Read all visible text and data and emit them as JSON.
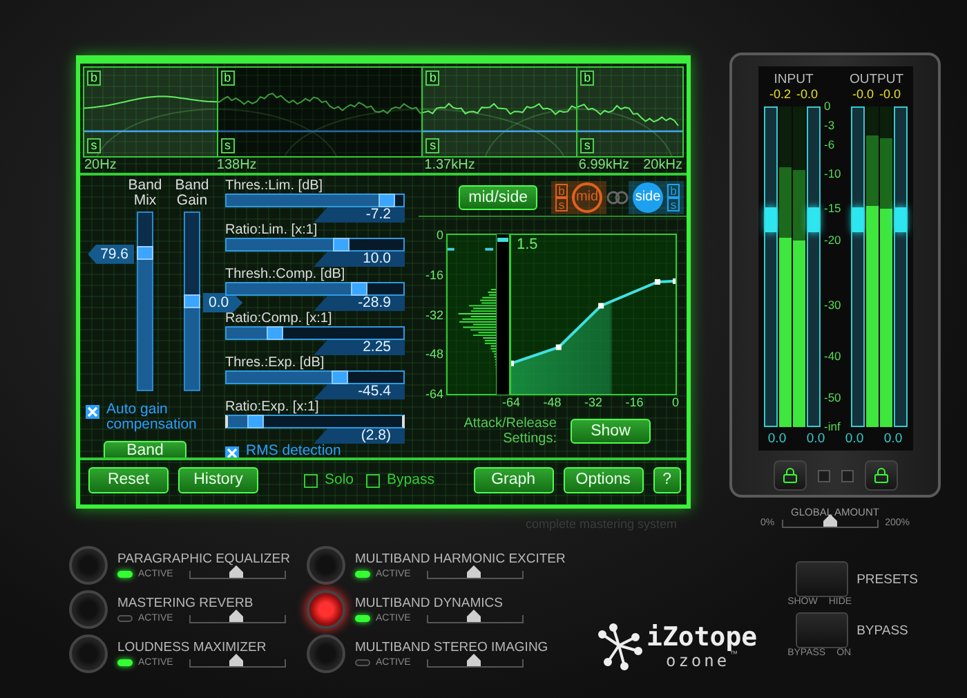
{
  "screen": {
    "spectrum": {
      "bands": [
        {
          "b": "b",
          "s": "s",
          "selected": false
        },
        {
          "b": "b",
          "s": "s",
          "selected": true
        },
        {
          "b": "b",
          "s": "s",
          "selected": false
        },
        {
          "b": "b",
          "s": "s",
          "selected": false
        }
      ],
      "freq_labels": [
        "20Hz",
        "138Hz",
        "1.37kHz",
        "6.99kHz",
        "20kHz"
      ]
    },
    "band_faders": [
      {
        "label": "Band Mix",
        "value": "79.6",
        "level": 0.77
      },
      {
        "label": "Band Gain",
        "value": "0.0",
        "level": 0.5
      }
    ],
    "auto_gain": {
      "label": "Auto gain compensation",
      "checked": true
    },
    "band_button": "Band",
    "sliders": [
      {
        "label": "Thres.:Lim. [dB]",
        "value": "-7.2",
        "level": 0.91,
        "selected": false
      },
      {
        "label": "Ratio:Lim. [x:1]",
        "value": "10.0",
        "level": 0.65,
        "selected": false
      },
      {
        "label": "Thresh.:Comp. [dB]",
        "value": "-28.9",
        "level": 0.75,
        "selected": false
      },
      {
        "label": "Ratio:Comp. [x:1]",
        "value": "2.25",
        "level": 0.27,
        "selected": false
      },
      {
        "label": "Thres.:Exp. [dB]",
        "value": "-45.4",
        "level": 0.64,
        "selected": false
      },
      {
        "label": "Ratio:Exp. [x:1]",
        "value": "(2.8)",
        "level": 0.16,
        "selected": true
      }
    ],
    "rms_detection": {
      "label": "RMS detection",
      "checked": true
    },
    "mid_side_button": "mid/side",
    "channels": [
      {
        "label": "mid",
        "b": "b",
        "s": "s",
        "selected": false,
        "color": "#e0601e"
      },
      {
        "label": "side",
        "b": "b",
        "s": "s",
        "selected": true,
        "color": "#1ea0f0"
      }
    ],
    "graph": {
      "ratio_reading": "1.5",
      "chart_data": {
        "type": "line",
        "x": [
          -64,
          -45.5,
          -29,
          -7,
          0
        ],
        "series": [
          {
            "color": "#40e0e0",
            "marker": "square",
            "values": [
              -51.7,
              -45.2,
              -28.5,
              -18.9,
              -18.6
            ]
          }
        ],
        "xlim": [
          -64,
          0
        ],
        "ylim": [
          -64,
          0
        ],
        "xticks": [
          {
            "value": -64,
            "label": "-64"
          },
          {
            "value": -48,
            "label": "-48"
          },
          {
            "value": -32,
            "label": "-32"
          },
          {
            "value": -16,
            "label": "-16"
          },
          {
            "value": 0,
            "label": "0"
          }
        ],
        "yticks": [
          {
            "value": 0,
            "label": "0"
          },
          {
            "value": -16,
            "label": "-16"
          },
          {
            "value": -32,
            "label": "-32"
          },
          {
            "value": -48,
            "label": "-48"
          },
          {
            "value": -64,
            "label": "-64"
          }
        ]
      }
    },
    "attack_release": {
      "label": "Attack/Release Settings:",
      "button": "Show"
    },
    "toolbar": [
      {
        "kind": "button",
        "label": "Reset"
      },
      {
        "kind": "button",
        "label": "History"
      },
      {
        "kind": "checkbox",
        "label": "Solo",
        "checked": false
      },
      {
        "kind": "checkbox",
        "label": "Bypass",
        "checked": false
      },
      {
        "kind": "button",
        "label": "Graph"
      },
      {
        "kind": "button",
        "label": "Options"
      },
      {
        "kind": "button",
        "label": "?"
      }
    ]
  },
  "tagline": "complete mastering system",
  "meters": {
    "groups": [
      {
        "title": "INPUT",
        "peaks": [
          "-0.2",
          "-0.0"
        ],
        "channel_levels": [
          {
            "level": 0.59
          },
          {
            "level": 0.58
          }
        ],
        "faders": [
          {
            "value": "0.0",
            "level": 0.65
          },
          {
            "value": "0.0",
            "level": 0.65
          }
        ]
      },
      {
        "title": "OUTPUT",
        "peaks": [
          "-0.0",
          "-0.0"
        ],
        "channel_levels": [
          {
            "level": 0.69
          },
          {
            "level": 0.68
          }
        ],
        "faders": [
          {
            "value": "0.0",
            "level": 0.65
          },
          {
            "value": "0.0",
            "level": 0.65
          }
        ]
      }
    ],
    "scale": [
      "0",
      "-3",
      "-6",
      "-10",
      "-15",
      "-20",
      "-30",
      "-40",
      "-50",
      "-inf"
    ]
  },
  "global_amount": {
    "label": "GLOBAL AMOUNT",
    "min": "0%",
    "max": "200%",
    "level": 0.5
  },
  "modules": [
    {
      "name": "PARAGRAPHIC EQUALIZER",
      "status": "ACTIVE",
      "active": true,
      "selected": false,
      "level": 0.48
    },
    {
      "name": "MULTIBAND HARMONIC EXCITER",
      "status": "ACTIVE",
      "active": true,
      "selected": false,
      "level": 0.48
    },
    {
      "name": "MASTERING REVERB",
      "status": "ACTIVE",
      "active": false,
      "selected": false,
      "level": 0.48
    },
    {
      "name": "MULTIBAND DYNAMICS",
      "status": "ACTIVE",
      "active": true,
      "selected": true,
      "level": 0.48
    },
    {
      "name": "LOUDNESS MAXIMIZER",
      "status": "ACTIVE",
      "active": true,
      "selected": false,
      "level": 0.48
    },
    {
      "name": "MULTIBAND STEREO IMAGING",
      "status": "ACTIVE",
      "active": false,
      "selected": false,
      "level": 0.48
    }
  ],
  "logo": {
    "brand": "iZotope",
    "product": "ozone",
    "mark": "™"
  },
  "switches": [
    {
      "title": "PRESETS",
      "off": "SHOW",
      "on": "HIDE",
      "active": false
    },
    {
      "title": "BYPASS",
      "off": "BYPASS",
      "on": "ON",
      "active": false
    }
  ]
}
